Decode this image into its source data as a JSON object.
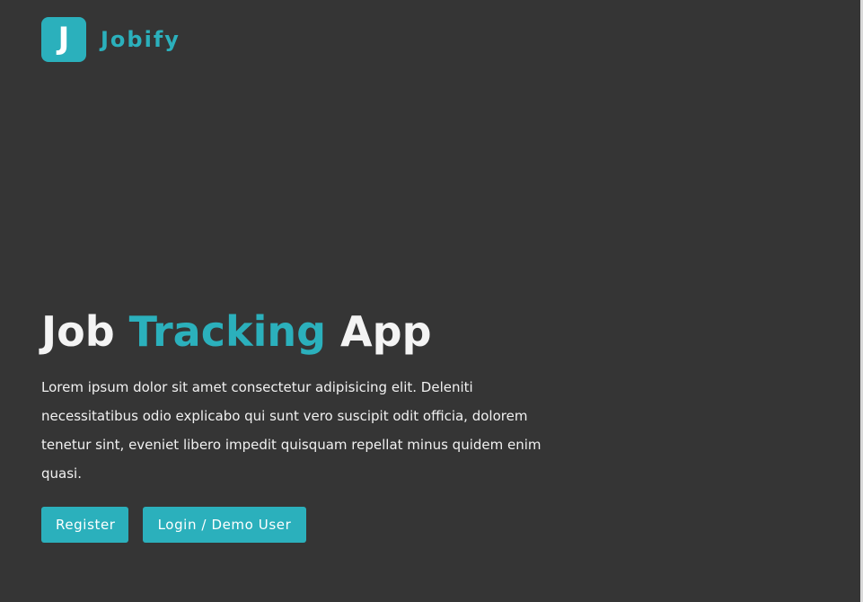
{
  "brand": {
    "logo_letter": "J",
    "name": "Jobify"
  },
  "hero": {
    "title_part1": "Job",
    "title_accent": "Tracking",
    "title_part2": "App",
    "body": "Lorem ipsum dolor sit amet consectetur adipisicing elit. Deleniti necessitatibus odio explicabo qui sunt vero suscipit odit officia, dolorem tenetur sint, eveniet libero impedit quisquam repellat minus quidem enim quasi.",
    "buttons": {
      "register": "Register",
      "login": "Login / Demo User"
    }
  },
  "colors": {
    "background": "#353535",
    "accent": "#2bb0bc",
    "text": "#f4f4f4"
  }
}
